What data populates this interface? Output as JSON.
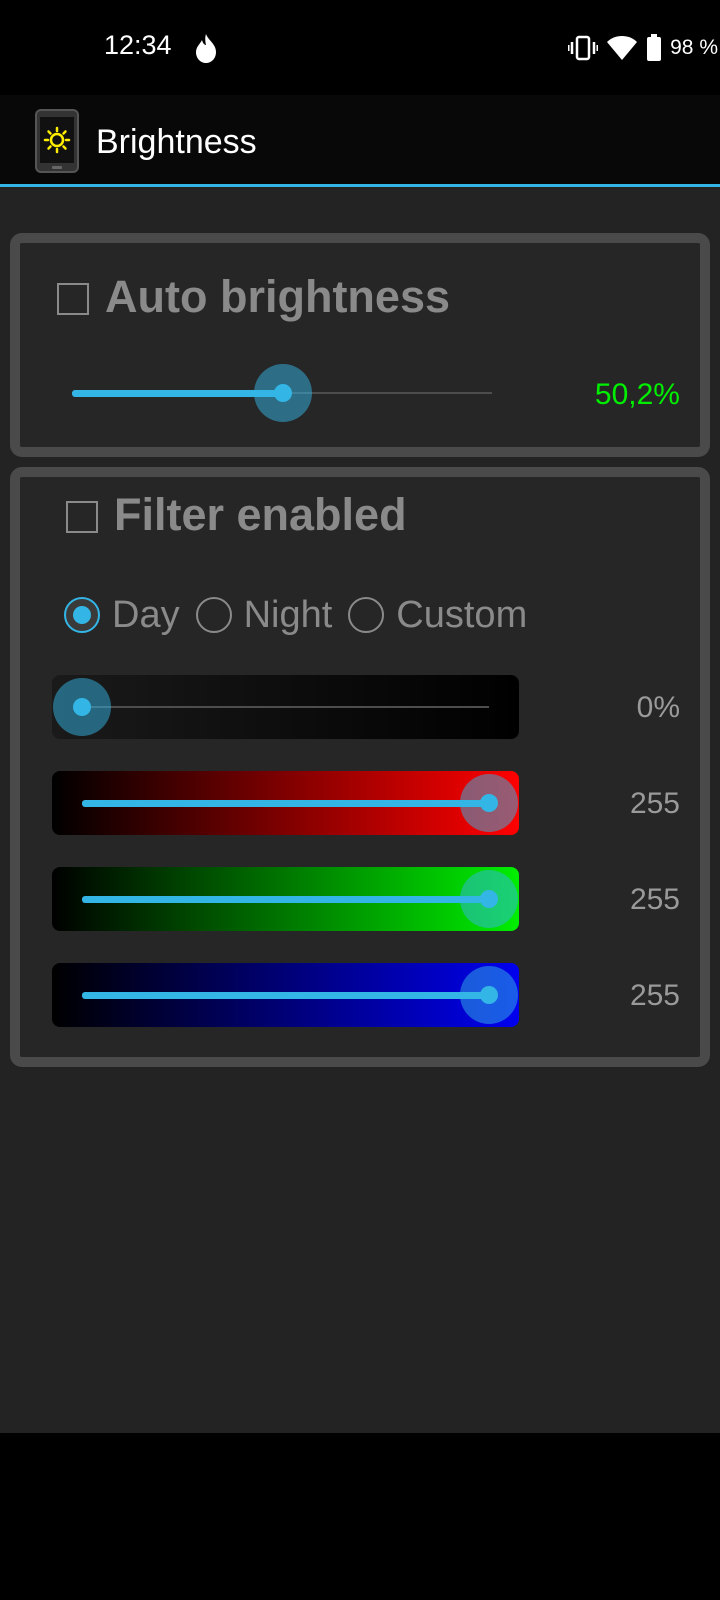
{
  "status_bar": {
    "time": "12:34",
    "battery_text": "98 %",
    "icons": [
      "fire-icon",
      "vibrate-icon",
      "wifi-icon",
      "battery-icon"
    ]
  },
  "app_bar": {
    "title": "Brightness",
    "icon": "brightness-phone-icon",
    "accent_color": "#33b5e5"
  },
  "auto_brightness": {
    "label": "Auto brightness",
    "checked": false,
    "level_fraction": 0.502,
    "value_text": "50,2%",
    "value_color": "#00ee00"
  },
  "filter": {
    "label": "Filter enabled",
    "checked": false,
    "modes": [
      {
        "label": "Day",
        "selected": true
      },
      {
        "label": "Night",
        "selected": false
      },
      {
        "label": "Custom",
        "selected": false
      }
    ],
    "sliders": [
      {
        "name": "brightness",
        "level_fraction": 0.0,
        "value_text": "0%"
      },
      {
        "name": "red",
        "level_fraction": 1.0,
        "value_text": "255"
      },
      {
        "name": "green",
        "level_fraction": 1.0,
        "value_text": "255"
      },
      {
        "name": "blue",
        "level_fraction": 1.0,
        "value_text": "255"
      }
    ]
  }
}
